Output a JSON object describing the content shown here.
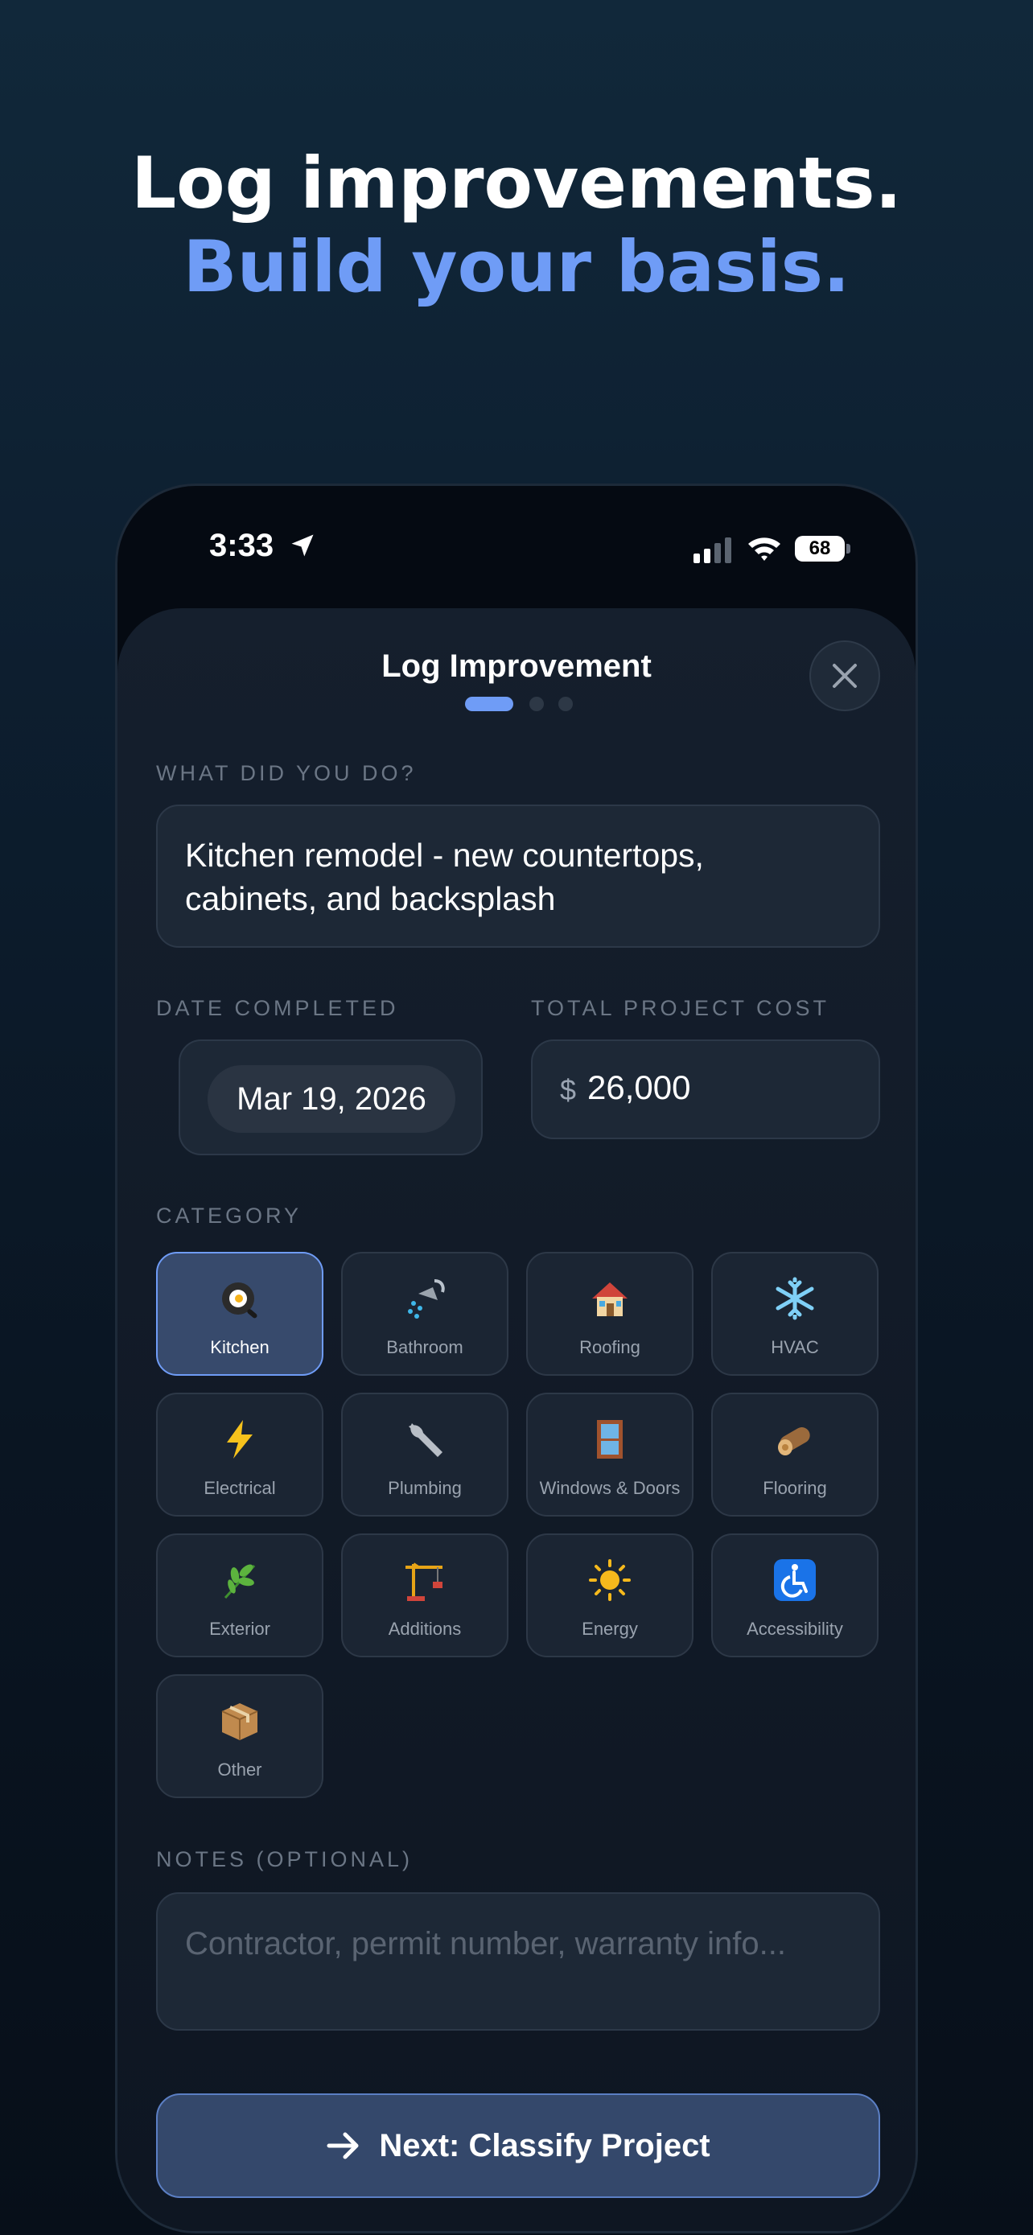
{
  "headline": {
    "line1": "Log improvements.",
    "line2": "Build your basis."
  },
  "status_bar": {
    "time": "3:33",
    "battery": "68"
  },
  "sheet": {
    "title": "Log Improvement",
    "step_total": 3,
    "step_current": 1
  },
  "description": {
    "label": "WHAT DID YOU DO?",
    "value_line1": "Kitchen remodel - new countertops,",
    "value_line2": "cabinets, and backsplash"
  },
  "date": {
    "label": "DATE COMPLETED",
    "value": "Mar 19, 2026"
  },
  "cost": {
    "label": "TOTAL PROJECT COST",
    "currency": "$",
    "value": "26,000"
  },
  "category": {
    "label": "CATEGORY",
    "selected": "Kitchen",
    "items": [
      {
        "label": "Kitchen",
        "icon": "frying-pan-icon"
      },
      {
        "label": "Bathroom",
        "icon": "shower-icon"
      },
      {
        "label": "Roofing",
        "icon": "house-icon"
      },
      {
        "label": "HVAC",
        "icon": "snowflake-icon"
      },
      {
        "label": "Electrical",
        "icon": "lightning-icon"
      },
      {
        "label": "Plumbing",
        "icon": "wrench-icon"
      },
      {
        "label": "Windows & Doors",
        "icon": "window-icon"
      },
      {
        "label": "Flooring",
        "icon": "wood-log-icon"
      },
      {
        "label": "Exterior",
        "icon": "herb-icon"
      },
      {
        "label": "Additions",
        "icon": "crane-icon"
      },
      {
        "label": "Energy",
        "icon": "sun-icon"
      },
      {
        "label": "Accessibility",
        "icon": "wheelchair-icon"
      },
      {
        "label": "Other",
        "icon": "package-icon"
      }
    ]
  },
  "notes": {
    "label": "NOTES (OPTIONAL)",
    "placeholder": "Contractor, permit number, warranty info..."
  },
  "next_button": {
    "label": "Next: Classify Project"
  },
  "colors": {
    "accent": "#6f9cf6",
    "selected_bg": "#374a6c"
  }
}
